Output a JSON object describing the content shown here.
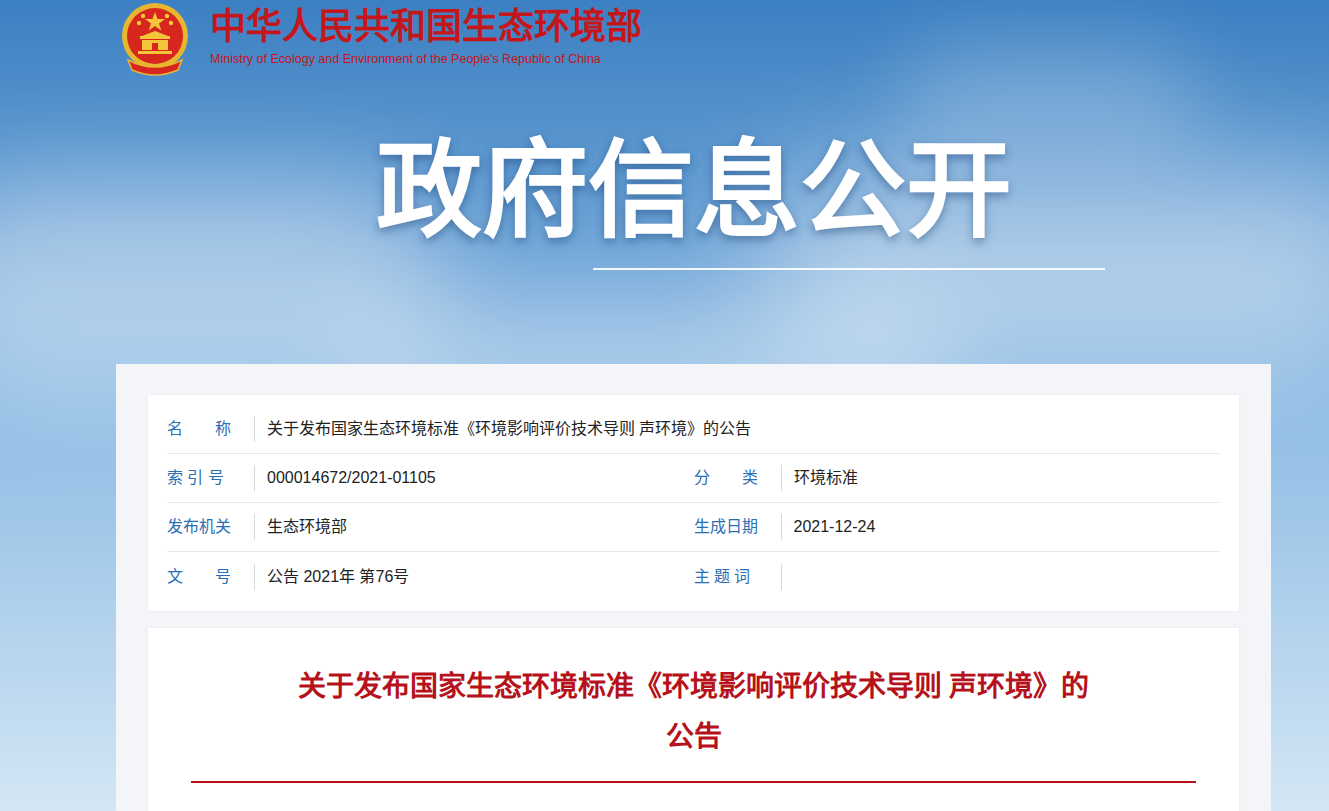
{
  "header": {
    "title": "中华人民共和国生态环境部",
    "subtitle": "Ministry of Ecology and Environment of the People's Republic of China"
  },
  "banner": {
    "title": "政府信息公开"
  },
  "meta": {
    "rows": [
      {
        "cells": [
          {
            "label": "名　　称",
            "value": "关于发布国家生态环境标准《环境影响评价技术导则 声环境》的公告"
          }
        ]
      },
      {
        "cells": [
          {
            "label": "索 引 号",
            "value": "000014672/2021-01105"
          },
          {
            "label": "分　　类",
            "value": "环境标准"
          }
        ]
      },
      {
        "cells": [
          {
            "label": "发布机关",
            "value": "生态环境部"
          },
          {
            "label": "生成日期",
            "value": "2021-12-24"
          }
        ]
      },
      {
        "cells": [
          {
            "label": "文　　号",
            "value": "公告 2021年 第76号"
          },
          {
            "label": "主 题 词",
            "value": ""
          }
        ]
      }
    ]
  },
  "article": {
    "title_line1": "关于发布国家生态环境标准《环境影响评价技术导则 声环境》的",
    "title_line2": "公告"
  }
}
